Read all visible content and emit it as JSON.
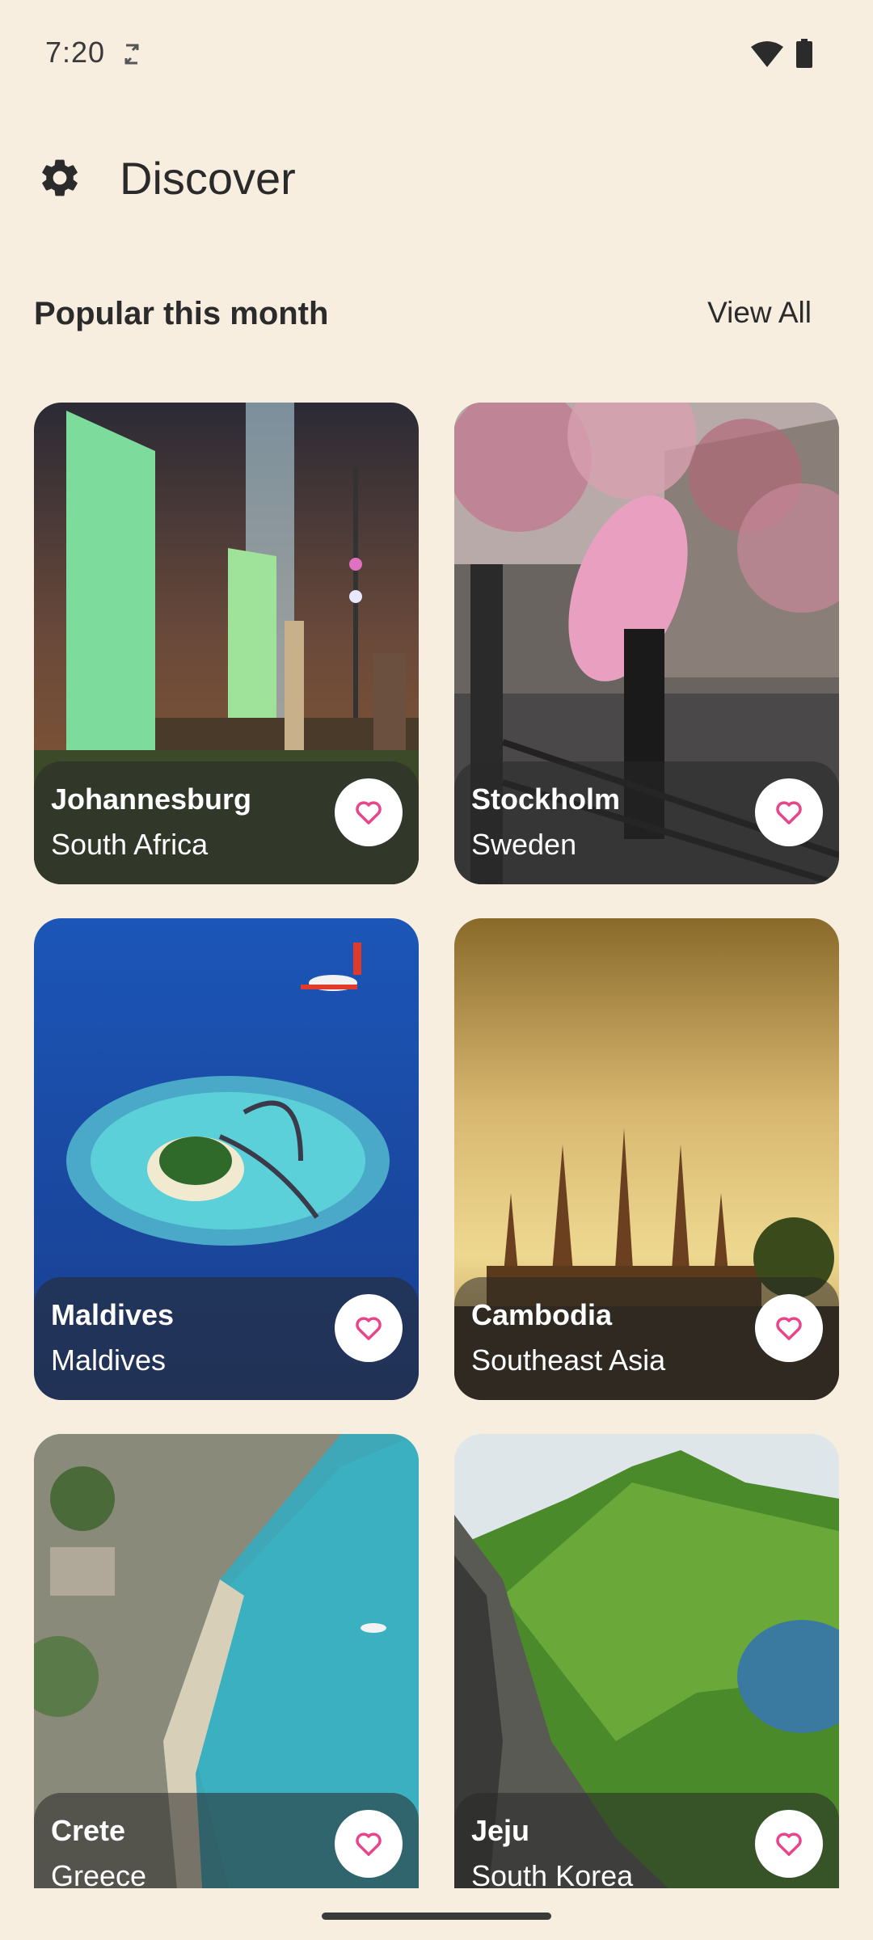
{
  "status_bar": {
    "time": "7:20",
    "sync_icon": "sync-icon",
    "wifi_icon": "wifi-icon",
    "battery_icon": "battery-icon"
  },
  "header": {
    "settings_icon": "gear-icon",
    "title": "Discover"
  },
  "section": {
    "title": "Popular this month",
    "view_all": "View All"
  },
  "destinations": [
    {
      "city": "Johannesburg",
      "country": "South Africa",
      "favorite_icon": "heart-outline-icon"
    },
    {
      "city": "Stockholm",
      "country": "Sweden",
      "favorite_icon": "heart-outline-icon"
    },
    {
      "city": "Maldives",
      "country": "Maldives",
      "favorite_icon": "heart-outline-icon"
    },
    {
      "city": "Cambodia",
      "country": "Southeast Asia",
      "favorite_icon": "heart-outline-icon"
    },
    {
      "city": "Crete",
      "country": "Greece",
      "favorite_icon": "heart-outline-icon"
    },
    {
      "city": "Jeju",
      "country": "South Korea",
      "favorite_icon": "heart-outline-icon"
    }
  ],
  "colors": {
    "background": "#F8EEE0",
    "heart": "#E8458B",
    "card_overlay": "#282828"
  }
}
